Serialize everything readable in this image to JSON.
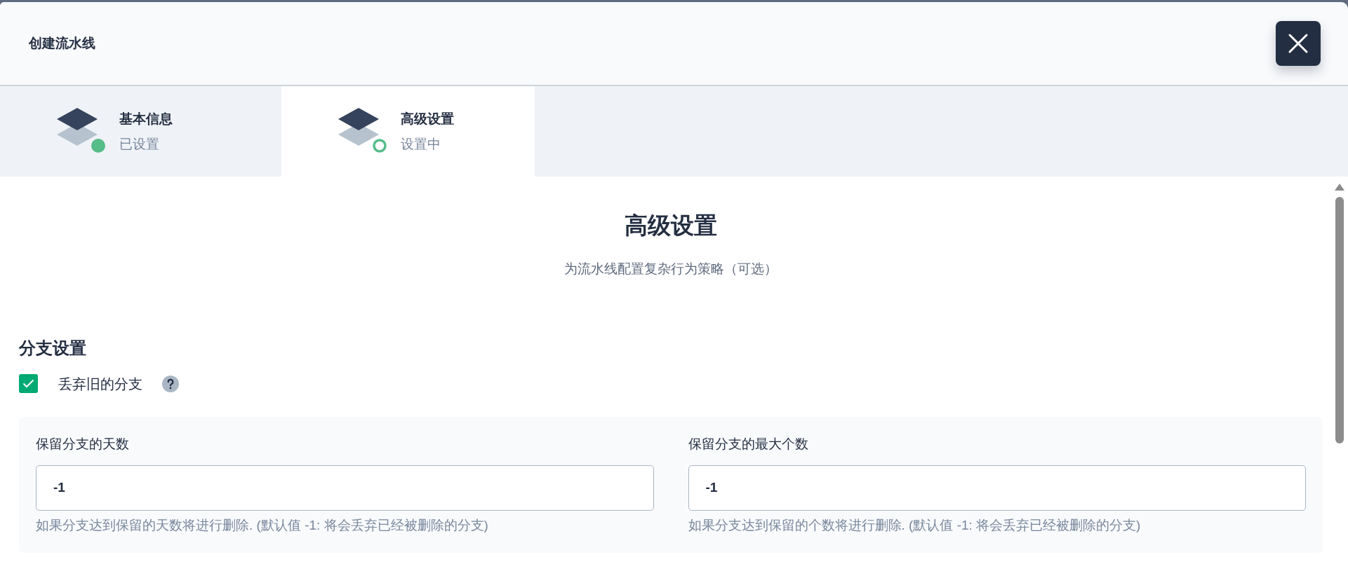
{
  "dialog": {
    "title": "创建流水线"
  },
  "steps": [
    {
      "title": "基本信息",
      "status_text": "已设置",
      "selected": false,
      "completed": true
    },
    {
      "title": "高级设置",
      "status_text": "设置中",
      "selected": true,
      "completed": false
    }
  ],
  "page": {
    "heading": "高级设置",
    "subtitle": "为流水线配置复杂行为策略（可选）"
  },
  "section": {
    "title": "分支设置",
    "checkbox": {
      "label": "丢弃旧的分支",
      "checked": true
    },
    "fields": [
      {
        "label": "保留分支的天数",
        "value": "-1",
        "hint": "如果分支达到保留的天数将进行删除. (默认值 -1: 将会丢弃已经被删除的分支)"
      },
      {
        "label": "保留分支的最大个数",
        "value": "-1",
        "hint": "如果分支达到保留的个数将进行删除. (默认值 -1: 将会丢弃已经被删除的分支)"
      }
    ]
  }
}
